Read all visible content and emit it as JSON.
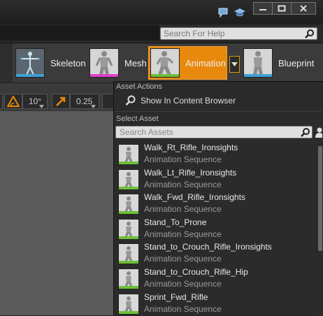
{
  "window": {
    "minimize_icon": "minimize-icon",
    "maximize_icon": "maximize-icon",
    "close_icon": "close-icon",
    "chat_icon": "speech-bubble-icon",
    "learn_icon": "graduation-cap-icon"
  },
  "help_search": {
    "placeholder": "Search For Help",
    "icon": "search-icon"
  },
  "modes": [
    {
      "label": "Skeleton",
      "accent": "#3ea0d8"
    },
    {
      "label": "Mesh",
      "accent": "#e040d0"
    },
    {
      "label": "Animation",
      "accent": "#e8880c"
    },
    {
      "label": "Blueprint",
      "accent": "#3ea0d8"
    }
  ],
  "viewport_toolbar": {
    "rotation_snap": "10°",
    "scale_snap": "0.25"
  },
  "menu": {
    "section_actions": "Asset Actions",
    "show_in_browser": "Show In Content Browser",
    "section_select": "Select Asset",
    "search_placeholder": "Search Assets",
    "assets": [
      {
        "name": "Walk_Rt_Rifle_Ironsights",
        "type": "Animation Sequence"
      },
      {
        "name": "Walk_Lt_Rifle_Ironsights",
        "type": "Animation Sequence"
      },
      {
        "name": "Walk_Fwd_Rifle_Ironsights",
        "type": "Animation Sequence"
      },
      {
        "name": "Stand_To_Prone",
        "type": "Animation Sequence"
      },
      {
        "name": "Stand_to_Crouch_Rifle_Ironsights",
        "type": "Animation Sequence"
      },
      {
        "name": "Stand_to_Crouch_Rifle_Hip",
        "type": "Animation Sequence"
      },
      {
        "name": "Sprint_Fwd_Rifle",
        "type": "Animation Sequence"
      }
    ]
  },
  "colors": {
    "accent_orange": "#e8880c",
    "anim_green": "#6fbf3a"
  }
}
